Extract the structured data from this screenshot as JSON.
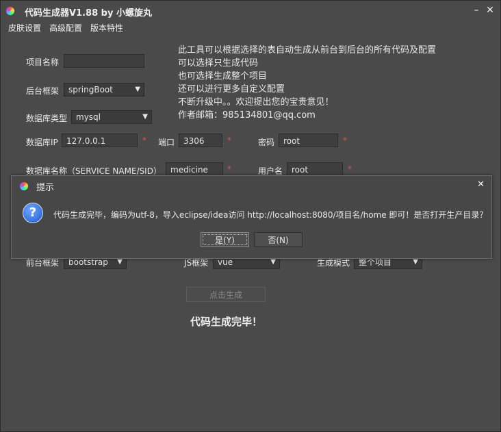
{
  "window": {
    "title": "代码生成器V1.88 by 小螺旋丸",
    "minimize": "–",
    "close": "✕"
  },
  "menu": [
    "皮肤设置",
    "高级配置",
    "版本特性"
  ],
  "info_lines": [
    "此工具可以根据选择的表自动生成从前台到后台的所有代码及配置",
    "可以选择只生成代码",
    "也可选择生成整个项目",
    "还可以进行更多自定义配置",
    "不断升级中。。欢迎提出您的宝贵意见！",
    "作者邮箱：985134801@qq.com"
  ],
  "form": {
    "project_name": {
      "label": "项目名称",
      "value": ""
    },
    "backend_framework": {
      "label": "后台框架",
      "value": "springBoot"
    },
    "db_type": {
      "label": "数据库类型",
      "value": "mysql"
    },
    "db_ip": {
      "label": "数据库IP",
      "value": "127.0.0.1"
    },
    "port": {
      "label": "端口",
      "value": "3306"
    },
    "password": {
      "label": "密码",
      "value": "root"
    },
    "db_name": {
      "label": "数据库名称（SERVICE NAME/SID）",
      "value": "medicine"
    },
    "username": {
      "label": "用户名",
      "value": "root"
    },
    "frontend_framework": {
      "label": "前台框架",
      "value": "bootstrap"
    },
    "js_framework": {
      "label": "JS框架",
      "value": "vue"
    },
    "gen_mode": {
      "label": "生成模式",
      "value": "整个项目"
    },
    "required_mark": "*"
  },
  "generate_button": "点击生成",
  "status_text": "代码生成完毕！",
  "dialog": {
    "title": "提示",
    "close": "✕",
    "icon": "?",
    "message": "代码生成完毕，编码为utf-8，导入eclipse/idea访问 http://localhost:8080/项目名/home 即可！是否打开生产目录？",
    "yes": "是(Y)",
    "no": "否(N)"
  }
}
